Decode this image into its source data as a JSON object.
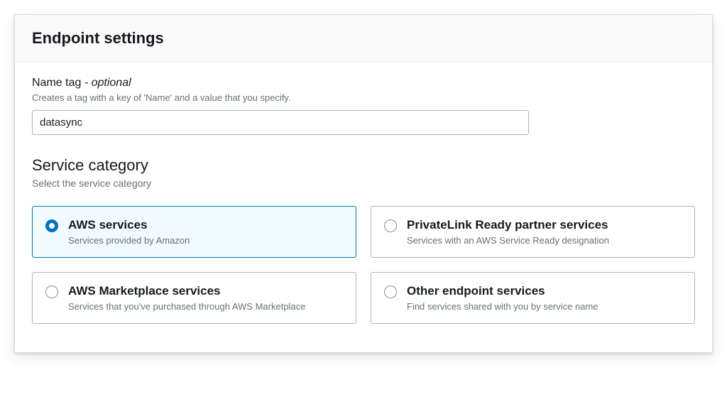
{
  "header": {
    "title": "Endpoint settings"
  },
  "nameTag": {
    "label": "Name tag",
    "optionalSuffix": " - optional",
    "hint": "Creates a tag with a key of 'Name' and a value that you specify.",
    "value": "datasync"
  },
  "serviceCategory": {
    "title": "Service category",
    "hint": "Select the service category",
    "options": {
      "aws": {
        "title": "AWS services",
        "desc": "Services provided by Amazon",
        "selected": true
      },
      "privatelink": {
        "title": "PrivateLink Ready partner services",
        "desc": "Services with an AWS Service Ready designation",
        "selected": false
      },
      "marketplace": {
        "title": "AWS Marketplace services",
        "desc": "Services that you've purchased through AWS Marketplace",
        "selected": false
      },
      "other": {
        "title": "Other endpoint services",
        "desc": "Find services shared with you by service name",
        "selected": false
      }
    }
  }
}
